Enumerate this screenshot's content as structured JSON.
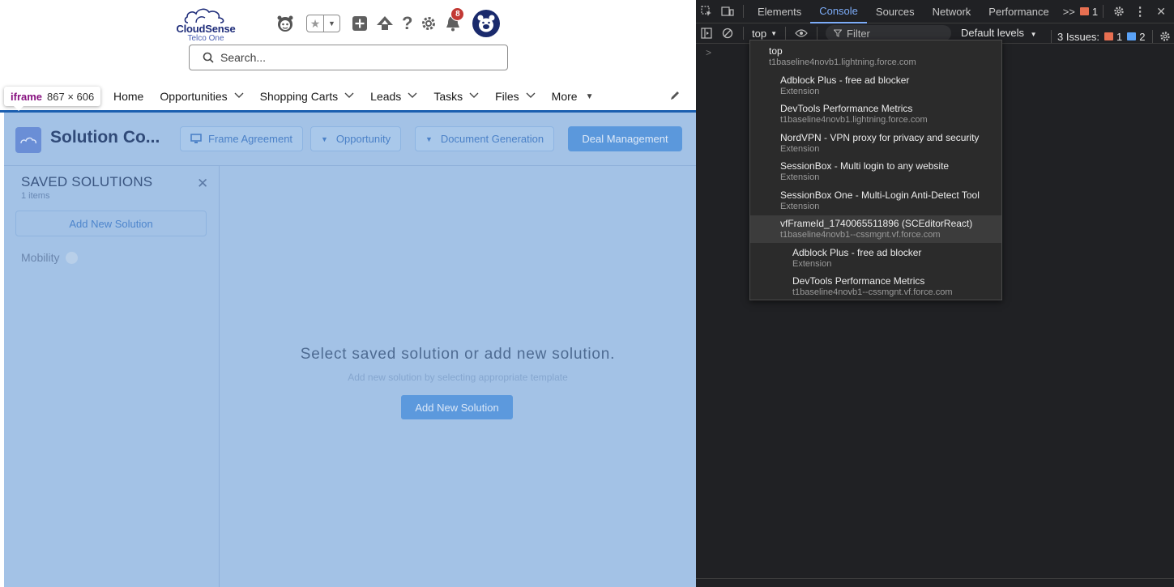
{
  "salesforce": {
    "logo": {
      "brand": "CloudSense",
      "sub": "Telco One"
    },
    "header_icons": [
      "astro-icon",
      "favorites-star-icon",
      "favorites-dropdown-icon",
      "global-actions-plus-icon",
      "trailhead-icon",
      "help-icon",
      "setup-gear-icon",
      "notifications-bell-icon",
      "user-avatar-icon"
    ],
    "notification_count": "8",
    "search_placeholder": "Search...",
    "iframe_label": {
      "tag": "iframe",
      "size": "867 × 606"
    },
    "nav": [
      {
        "label": "Home",
        "chevron": false
      },
      {
        "label": "Opportunities",
        "chevron": true
      },
      {
        "label": "Shopping Carts",
        "chevron": true
      },
      {
        "label": "Leads",
        "chevron": true
      },
      {
        "label": "Tasks",
        "chevron": true
      },
      {
        "label": "Files",
        "chevron": true
      },
      {
        "label": "More",
        "chevron": "caret"
      }
    ]
  },
  "app": {
    "title": "Solution Co...",
    "buttons": {
      "frame_agreement": "Frame Agreement",
      "opportunity": "Opportunity",
      "document_generation": "Document Generation",
      "deal_management": "Deal Management"
    },
    "sidebar": {
      "title": "SAVED SOLUTIONS",
      "count": "1 items",
      "add_button": "Add New Solution",
      "items": [
        {
          "label": "Mobility"
        }
      ]
    },
    "empty": {
      "title": "Select saved solution or add new solution.",
      "subtitle": "Add new solution by selecting appropriate template",
      "button": "Add New Solution"
    },
    "colors": {
      "overlay": "#a3c2e6",
      "primary_button": "#5b98dc",
      "nav_underline": "#1b5fb0"
    }
  },
  "devtools": {
    "tabs": [
      "Elements",
      "Console",
      "Sources",
      "Network",
      "Performance"
    ],
    "active_tab": "Console",
    "more_tabs": ">>",
    "tab_warning_count": "1",
    "context": "top",
    "filter_placeholder": "Filter",
    "levels": "Default levels",
    "issues": {
      "label": "3 Issues:",
      "warnings": "1",
      "info": "2"
    },
    "prompt": ">",
    "context_menu": [
      {
        "title": "top",
        "subtitle": "t1baseline4novb1.lightning.force.com",
        "indent": 0,
        "selected": false
      },
      {
        "title": "Adblock Plus - free ad blocker",
        "subtitle": "Extension",
        "indent": 1,
        "selected": false
      },
      {
        "title": "DevTools Performance Metrics",
        "subtitle": "t1baseline4novb1.lightning.force.com",
        "indent": 1,
        "selected": false
      },
      {
        "title": "NordVPN - VPN proxy for privacy and security",
        "subtitle": "Extension",
        "indent": 1,
        "selected": false
      },
      {
        "title": "SessionBox - Multi login to any website",
        "subtitle": "Extension",
        "indent": 1,
        "selected": false
      },
      {
        "title": "SessionBox One - Multi-Login Anti-Detect Tool",
        "subtitle": "Extension",
        "indent": 1,
        "selected": false
      },
      {
        "title": "vfFrameId_1740065511896 (SCEditorReact)",
        "subtitle": "t1baseline4novb1--cssmgnt.vf.force.com",
        "indent": 1,
        "selected": true
      },
      {
        "title": "Adblock Plus - free ad blocker",
        "subtitle": "Extension",
        "indent": 2,
        "selected": false
      },
      {
        "title": "DevTools Performance Metrics",
        "subtitle": "t1baseline4novb1--cssmgnt.vf.force.com",
        "indent": 2,
        "selected": false
      }
    ]
  }
}
